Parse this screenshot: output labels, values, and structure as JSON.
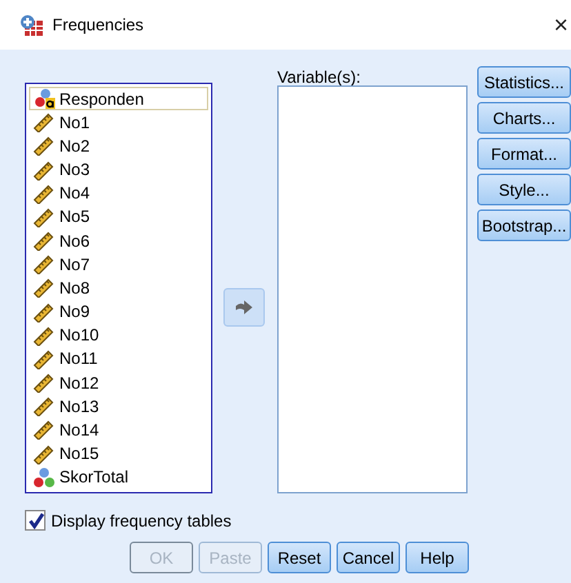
{
  "window": {
    "title": "Frequencies",
    "close": "×"
  },
  "source_list": [
    {
      "label": "Responden",
      "kind": "string",
      "selected": true
    },
    {
      "label": "No1",
      "kind": "scale",
      "selected": false
    },
    {
      "label": "No2",
      "kind": "scale",
      "selected": false
    },
    {
      "label": "No3",
      "kind": "scale",
      "selected": false
    },
    {
      "label": "No4",
      "kind": "scale",
      "selected": false
    },
    {
      "label": "No5",
      "kind": "scale",
      "selected": false
    },
    {
      "label": "No6",
      "kind": "scale",
      "selected": false
    },
    {
      "label": "No7",
      "kind": "scale",
      "selected": false
    },
    {
      "label": "No8",
      "kind": "scale",
      "selected": false
    },
    {
      "label": "No9",
      "kind": "scale",
      "selected": false
    },
    {
      "label": "No10",
      "kind": "scale",
      "selected": false
    },
    {
      "label": "No11",
      "kind": "scale",
      "selected": false
    },
    {
      "label": "No12",
      "kind": "scale",
      "selected": false
    },
    {
      "label": "No13",
      "kind": "scale",
      "selected": false
    },
    {
      "label": "No14",
      "kind": "scale",
      "selected": false
    },
    {
      "label": "No15",
      "kind": "scale",
      "selected": false
    },
    {
      "label": "SkorTotal",
      "kind": "nominal",
      "selected": false
    }
  ],
  "variables_label": "Variable(s):",
  "side_buttons": [
    "Statistics...",
    "Charts...",
    "Format...",
    "Style...",
    "Bootstrap..."
  ],
  "display_frequency_tables": {
    "label": "Display frequency tables",
    "checked": true
  },
  "buttons": [
    {
      "label": "OK",
      "disabled": true
    },
    {
      "label": "Paste",
      "disabled": true
    },
    {
      "label": "Reset",
      "disabled": false
    },
    {
      "label": "Cancel",
      "disabled": false
    },
    {
      "label": "Help",
      "disabled": false
    }
  ]
}
